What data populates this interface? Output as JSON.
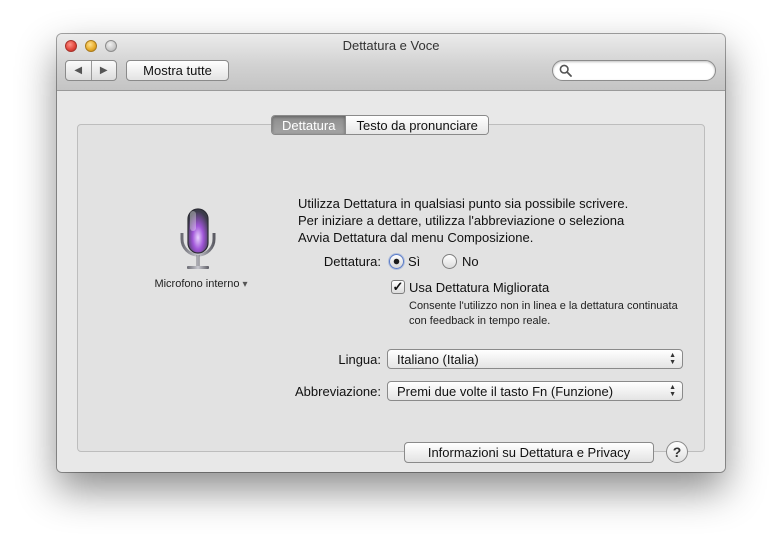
{
  "window": {
    "title": "Dettatura e Voce",
    "show_all_label": "Mostra tutte",
    "search_placeholder": ""
  },
  "tabs": [
    {
      "label": "Dettatura",
      "active": true
    },
    {
      "label": "Testo da pronunciare",
      "active": false
    }
  ],
  "microphone": {
    "label": "Microfono interno",
    "dropdown_arrow": "▾"
  },
  "intro": {
    "line1": "Utilizza Dettatura in qualsiasi punto sia possibile scrivere.",
    "line2": "Per iniziare a dettare, utilizza l'abbreviazione o seleziona",
    "line3": "Avvia Dettatura dal menu Composizione."
  },
  "dictation": {
    "label": "Dettatura:",
    "option_on": "Sì",
    "option_off": "No",
    "selected": "Sì"
  },
  "enhanced": {
    "label": "Usa Dettatura Migliorata",
    "checked": true,
    "description": "Consente l'utilizzo non in linea e la dettatura continuata con feedback in tempo reale."
  },
  "language": {
    "label": "Lingua:",
    "value": "Italiano (Italia)"
  },
  "shortcut": {
    "label": "Abbreviazione:",
    "value": "Premi due volte il tasto Fn (Funzione)"
  },
  "privacy_button_label": "Informazioni su Dettatura e Privacy",
  "help_label": "?",
  "colors": {
    "accent": "#5a7bc8",
    "mic_glow": "#a055d8"
  }
}
